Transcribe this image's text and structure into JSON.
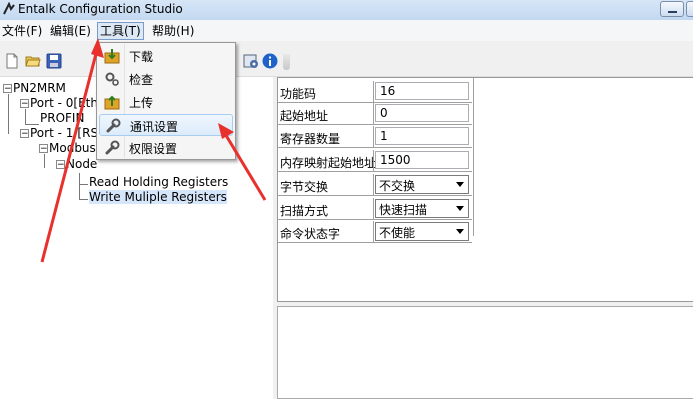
{
  "window": {
    "title": "Entalk Configuration Studio"
  },
  "menubar": {
    "items": [
      {
        "label": "文件(F)"
      },
      {
        "label": "编辑(E)"
      },
      {
        "label": "工具(T)"
      },
      {
        "label": "帮助(H)"
      }
    ]
  },
  "toolbar": {
    "icons": [
      "new-file-icon",
      "open-folder-icon",
      "save-icon",
      "settings-icon",
      "info-icon"
    ]
  },
  "tools_menu": {
    "items": [
      {
        "label": "下载",
        "icon": "download-icon"
      },
      {
        "label": "检查",
        "icon": "check-gears-icon"
      },
      {
        "label": "上传",
        "icon": "upload-icon"
      },
      {
        "label": "通讯设置",
        "icon": "wrench-icon",
        "highlighted": true
      },
      {
        "label": "权限设置",
        "icon": "wrench-icon"
      }
    ]
  },
  "tree": {
    "nodes": [
      {
        "label": "PN2MRM"
      },
      {
        "label": "Port - 0[Eth"
      },
      {
        "label": "PROFIN"
      },
      {
        "label": "Port - 1:[RS"
      },
      {
        "label": "Modbus"
      },
      {
        "label": "Node"
      },
      {
        "label": "Read Holding Registers"
      },
      {
        "label": "Write Muliple Registers",
        "selected": true
      }
    ]
  },
  "properties": {
    "rows": [
      {
        "label": "功能码",
        "value": "16",
        "type": "input"
      },
      {
        "label": "起始地址",
        "value": "0",
        "type": "input"
      },
      {
        "label": "寄存器数量",
        "value": "1",
        "type": "input"
      },
      {
        "label": "内存映射起始地址",
        "value": "1500",
        "type": "input"
      },
      {
        "label": "字节交换",
        "value": "不交换",
        "type": "select"
      },
      {
        "label": "扫描方式",
        "value": "快速扫描",
        "type": "select"
      },
      {
        "label": "命令状态字",
        "value": "不使能",
        "type": "select"
      }
    ]
  },
  "colors": {
    "annotation_arrow": "#e8302c",
    "highlight": "#dcebfa",
    "selection": "#d6e6fa"
  }
}
